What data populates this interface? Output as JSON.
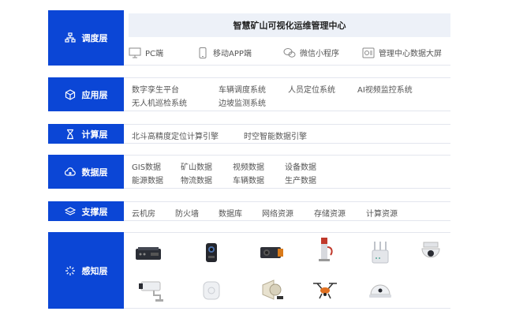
{
  "layers": {
    "dispatch": {
      "label": "调度层",
      "title": "智慧矿山可视化运维管理中心",
      "clients": [
        "PC端",
        "移动APP端",
        "微信小程序",
        "管理中心数据大屏"
      ]
    },
    "application": {
      "label": "应用层",
      "items": [
        "数字孪生平台",
        "车辆调度系统",
        "人员定位系统",
        "AI视频监控系统",
        "无人机巡检系统",
        "边坡监测系统"
      ]
    },
    "compute": {
      "label": "计算层",
      "items": [
        "北斗高精度定位计算引擎",
        "时空智能数据引擎"
      ]
    },
    "data": {
      "label": "数据层",
      "items": [
        "GIS数据",
        "矿山数据",
        "视频数据",
        "设备数据",
        "能源数据",
        "物流数据",
        "车辆数据",
        "生产数据"
      ]
    },
    "support": {
      "label": "支撑层",
      "items": [
        "云机房",
        "防火墙",
        "数据库",
        "网络资源",
        "存储资源",
        "计算资源"
      ]
    },
    "perception": {
      "label": "感知层",
      "devices": [
        "data-terminal-icon",
        "body-camera-icon",
        "lidar-icon",
        "charging-pile-icon",
        "router-icon",
        "dome-camera-icon",
        "bullet-camera-icon",
        "tag-icon",
        "speaker-icon",
        "drone-icon",
        "helmet-icon"
      ]
    }
  },
  "colors": {
    "label_bg": "#0b46d6",
    "title_bg": "#edf1f8"
  }
}
